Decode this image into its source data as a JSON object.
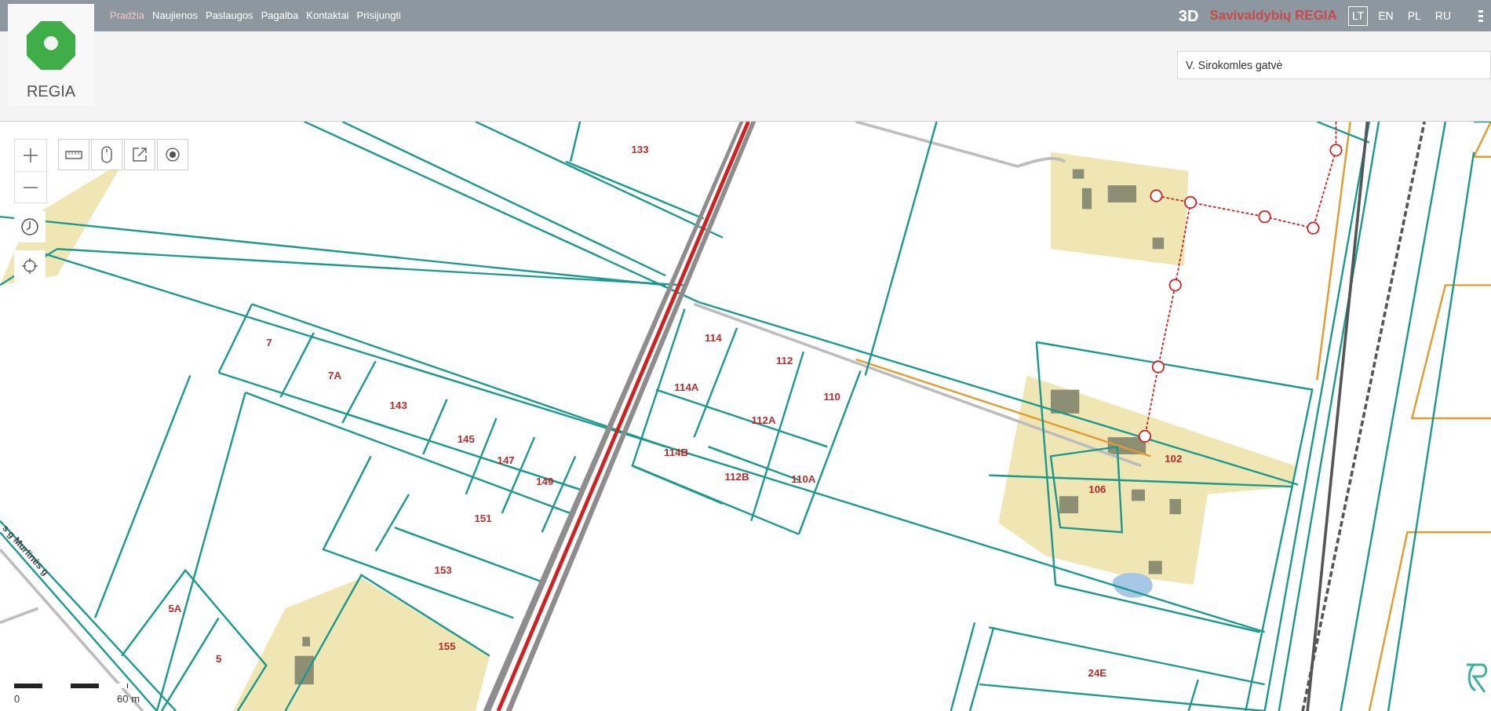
{
  "header": {
    "nav": [
      {
        "label": "Pradžia",
        "selected": true
      },
      {
        "label": "Naujienos",
        "selected": false
      },
      {
        "label": "Paslaugos",
        "selected": false
      },
      {
        "label": "Pagalba",
        "selected": false
      },
      {
        "label": "Kontaktai",
        "selected": false
      },
      {
        "label": "Prisijungti",
        "selected": false
      }
    ],
    "mode_3d": "3D",
    "brand": "Savivaldybių REGIA",
    "languages": [
      {
        "label": "LT",
        "selected": true
      },
      {
        "label": "EN",
        "selected": false
      },
      {
        "label": "PL",
        "selected": false
      },
      {
        "label": "RU",
        "selected": false
      }
    ]
  },
  "logo": {
    "text": "REGIA"
  },
  "search": {
    "value": "V. Sirokomles gatvė"
  },
  "map": {
    "parcels": [
      {
        "label": "133"
      },
      {
        "label": "7"
      },
      {
        "label": "7A"
      },
      {
        "label": "143"
      },
      {
        "label": "145"
      },
      {
        "label": "147"
      },
      {
        "label": "149"
      },
      {
        "label": "151"
      },
      {
        "label": "153"
      },
      {
        "label": "5A"
      },
      {
        "label": "5"
      },
      {
        "label": "155"
      },
      {
        "label": "114"
      },
      {
        "label": "112"
      },
      {
        "label": "114A"
      },
      {
        "label": "112A"
      },
      {
        "label": "110"
      },
      {
        "label": "114B"
      },
      {
        "label": "112B"
      },
      {
        "label": "110A"
      },
      {
        "label": "102"
      },
      {
        "label": "106"
      },
      {
        "label": "24E"
      }
    ],
    "street_labels": [
      "s g Murlinės g"
    ],
    "scale": {
      "start": "0",
      "end": "60 m"
    }
  }
}
